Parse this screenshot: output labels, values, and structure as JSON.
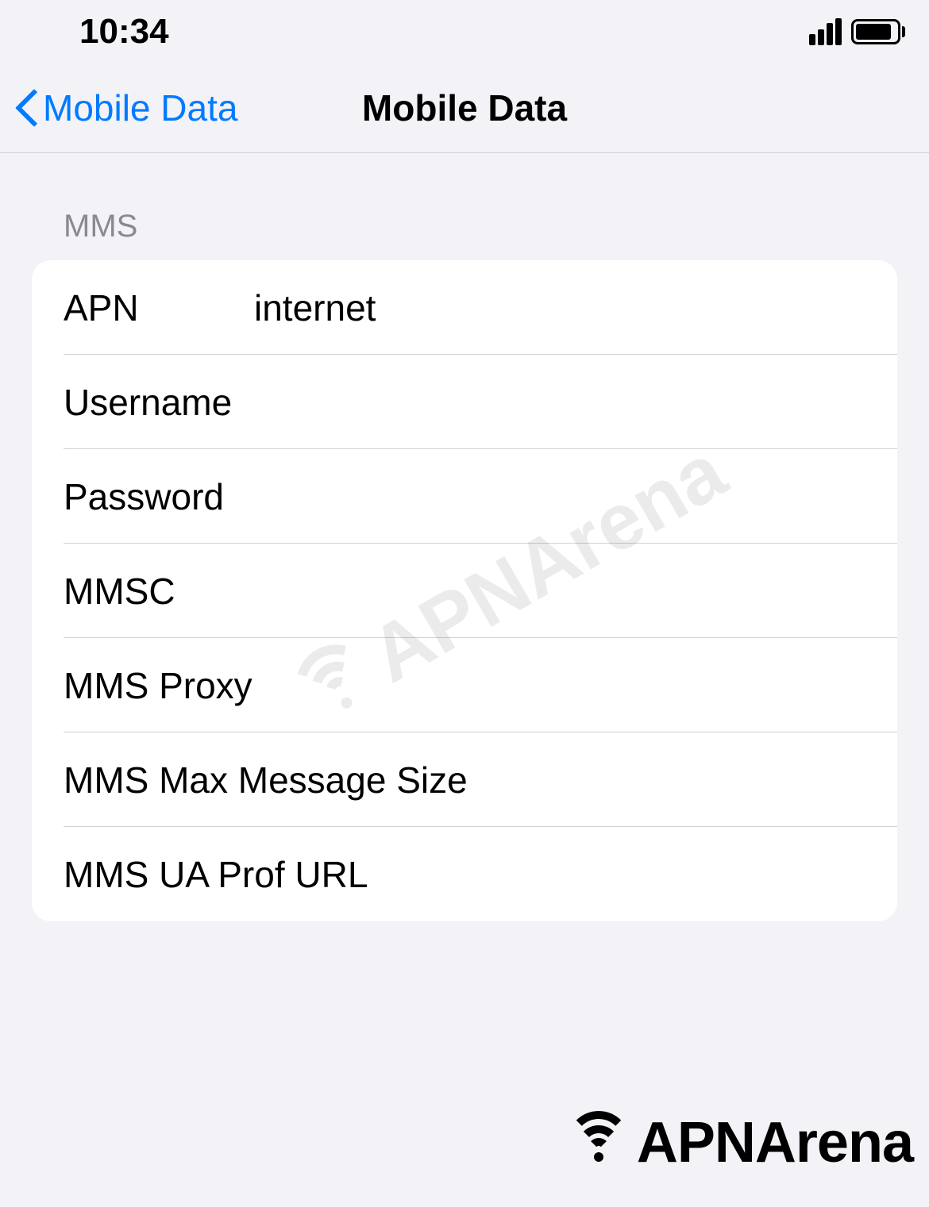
{
  "status": {
    "time": "10:34"
  },
  "nav": {
    "back_label": "Mobile Data",
    "title": "Mobile Data"
  },
  "section": {
    "header": "MMS",
    "rows": [
      {
        "label": "APN",
        "value": "internet"
      },
      {
        "label": "Username",
        "value": ""
      },
      {
        "label": "Password",
        "value": ""
      },
      {
        "label": "MMSC",
        "value": ""
      },
      {
        "label": "MMS Proxy",
        "value": ""
      },
      {
        "label": "MMS Max Message Size",
        "value": ""
      },
      {
        "label": "MMS UA Prof URL",
        "value": ""
      }
    ]
  },
  "watermark": "APNArena",
  "brand": "APNArena"
}
